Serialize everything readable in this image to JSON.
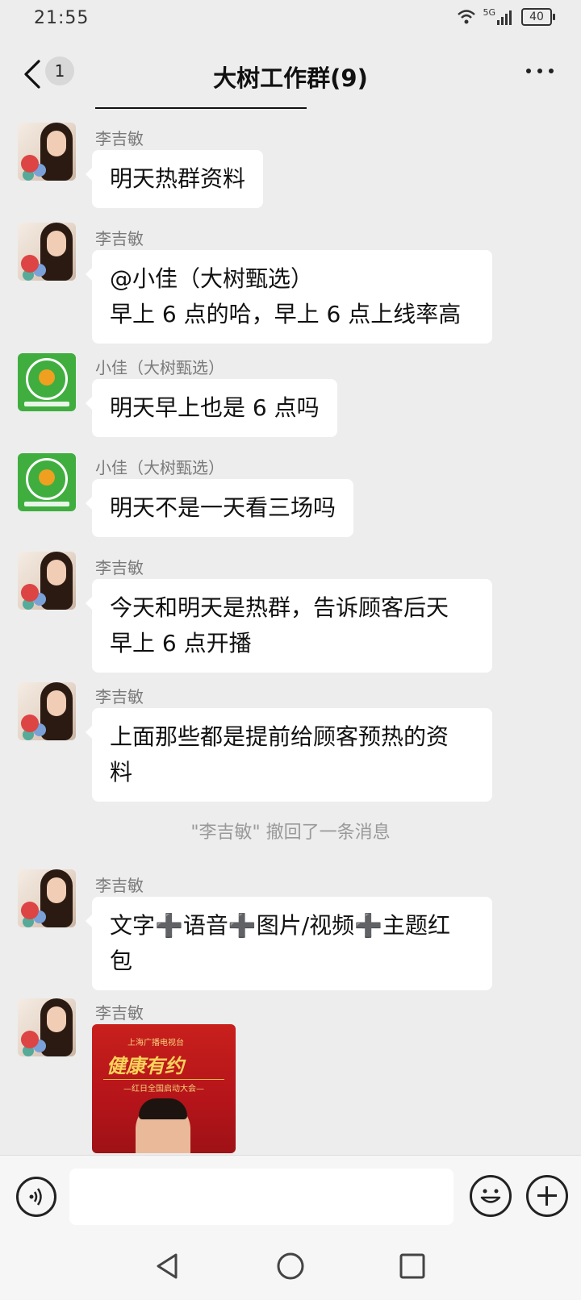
{
  "status": {
    "time": "21:55",
    "network": "5G",
    "battery": "40"
  },
  "header": {
    "unread_count": "1",
    "title": "大树工作群(9)"
  },
  "messages": [
    {
      "sender": "李吉敏",
      "lines": [
        "明天热群资料"
      ]
    },
    {
      "sender": "李吉敏",
      "lines": [
        "@小佳（大树甄选）",
        "早上 6 点的哈，早上 6 点上线率高"
      ]
    },
    {
      "sender": "小佳（大树甄选）",
      "lines": [
        "明天早上也是 6 点吗"
      ]
    },
    {
      "sender": "小佳（大树甄选）",
      "lines": [
        "明天不是一天看三场吗"
      ]
    },
    {
      "sender": "李吉敏",
      "lines": [
        "今天和明天是热群，告诉顾客后天",
        "早上 6 点开播"
      ]
    },
    {
      "sender": "李吉敏",
      "lines": [
        "上面那些都是提前给顾客预热的资",
        "料"
      ]
    },
    {
      "sender": "李吉敏",
      "lines": [
        "文字➕语音➕图片/视频➕主题红",
        "包"
      ]
    },
    {
      "sender": "李吉敏",
      "image": {
        "brand": "上海广播电视台",
        "headline": "健康有约",
        "subline": "—红日全国启动大会—"
      }
    }
  ],
  "system_notice": "\"李吉敏\" 撤回了一条消息",
  "icons": {
    "back": "back-arrow-icon",
    "more": "more-icon",
    "voice": "voice-icon",
    "emoji": "emoji-icon",
    "add": "plus-icon",
    "nav_back": "triangle-back-icon",
    "nav_home": "circle-home-icon",
    "nav_recent": "square-recent-icon"
  },
  "colors": {
    "background": "#ededed",
    "bubble": "#ffffff",
    "sender": "#7a7a7a",
    "logo_green": "#3fae3f"
  }
}
